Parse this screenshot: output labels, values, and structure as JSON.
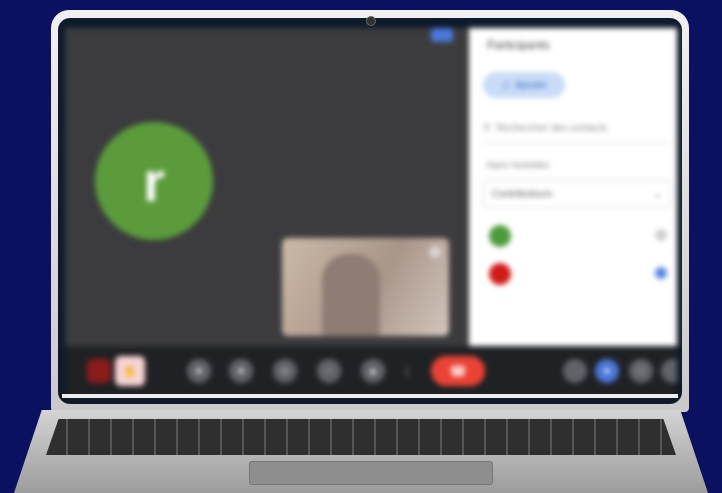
{
  "meeting": {
    "avatar_initial": "r",
    "self_name": "",
    "control_icons": [
      "more-icon",
      "hand-icon",
      "camera-icon",
      "mic-icon",
      "emoji-icon",
      "cc-icon",
      "present-icon",
      "options-icon"
    ],
    "end_call_icon": "phone-icon"
  },
  "participants_panel": {
    "title": "Participants",
    "add_button_label": "Ajouter",
    "search_placeholder": "Rechercher des contacts",
    "section_label": "Dans l'entretien",
    "select_value": "Contributeurs",
    "participants": [
      {
        "name": "",
        "subtitle": "",
        "color": "#4e9a3b"
      },
      {
        "name": "",
        "subtitle": "",
        "color": "#d11a1a"
      }
    ]
  },
  "colors": {
    "background": "#0b1160",
    "call_bg": "#3c3c3e",
    "end_call": "#ea4335",
    "accent_blue": "#4a78d8",
    "avatar_green": "#5b9b3c"
  }
}
